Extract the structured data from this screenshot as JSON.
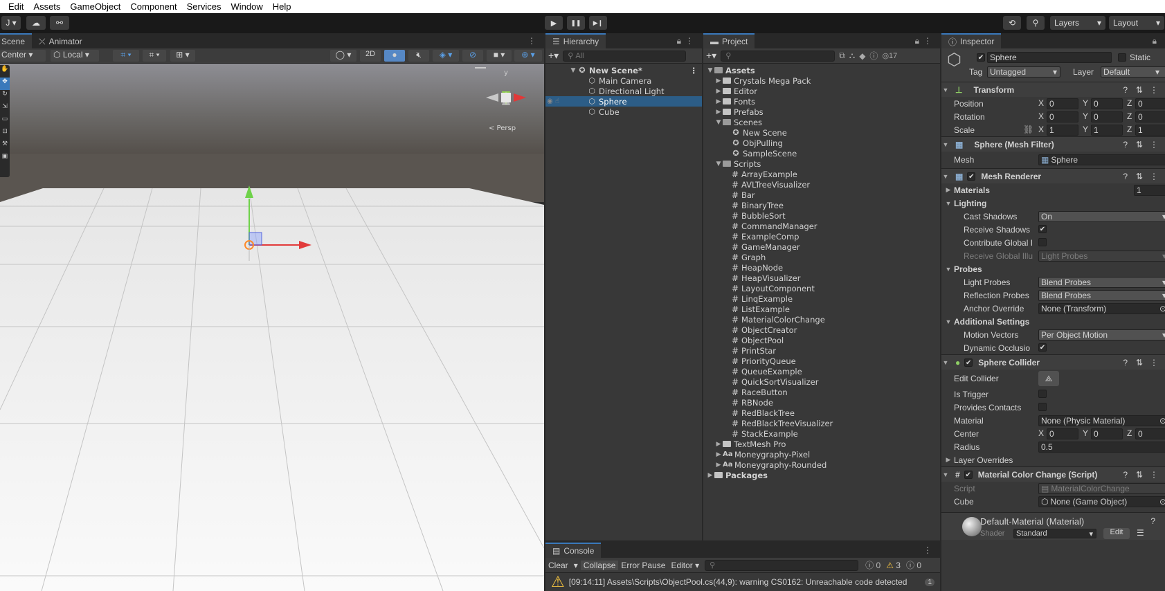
{
  "menu": [
    "Edit",
    "Assets",
    "GameObject",
    "Component",
    "Services",
    "Window",
    "Help"
  ],
  "toolbar": {
    "account": "J",
    "play": "▶",
    "pause": "❚❚",
    "step": "▶❙",
    "layers": "Layers",
    "layout": "Layout"
  },
  "scene": {
    "tabs": [
      "Scene",
      "Animator"
    ],
    "pivot": "Center",
    "space": "Local",
    "mode2d": "2D",
    "persp": "< Persp",
    "gizmo_y": "y"
  },
  "hierarchy": {
    "title": "Hierarchy",
    "search_placeholder": "All",
    "scene": "New Scene*",
    "items": [
      "Main Camera",
      "Directional Light",
      "Sphere",
      "Cube"
    ]
  },
  "project": {
    "title": "Project",
    "count": "17",
    "root": "Assets",
    "folders_top": [
      "Crystals Mega Pack",
      "Editor",
      "Fonts",
      "Prefabs"
    ],
    "scenes_folder": "Scenes",
    "scenes": [
      "New Scene",
      "ObjPulling",
      "SampleScene"
    ],
    "scripts_folder": "Scripts",
    "scripts": [
      "ArrayExample",
      "AVLTreeVisualizer",
      "Bar",
      "BinaryTree",
      "BubbleSort",
      "CommandManager",
      "ExampleComp",
      "GameManager",
      "Graph",
      "HeapNode",
      "HeapVisualizer",
      "LayoutComponent",
      "LinqExample",
      "ListExample",
      "MaterialColorChange",
      "ObjectCreator",
      "ObjectPool",
      "PrintStar",
      "PriorityQueue",
      "QueueExample",
      "QuickSortVisualizer",
      "RaceButton",
      "RBNode",
      "RedBlackTree",
      "RedBlackTreeVisualizer",
      "StackExample"
    ],
    "folders_bottom": [
      "TextMesh Pro"
    ],
    "fonts": [
      "Moneygraphy-Pixel",
      "Moneygraphy-Rounded"
    ],
    "packages": "Packages"
  },
  "console": {
    "title": "Console",
    "clear": "Clear",
    "collapse": "Collapse",
    "error_pause": "Error Pause",
    "editor": "Editor",
    "info_count": "0",
    "warn_count": "3",
    "error_count": "0",
    "message": "[09:14:11] Assets\\Scripts\\ObjectPool.cs(44,9): warning CS0162: Unreachable code detected",
    "msg_count": "1"
  },
  "inspector": {
    "title": "Inspector",
    "object_name": "Sphere",
    "static_label": "Static",
    "tag_label": "Tag",
    "tag": "Untagged",
    "layer_label": "Layer",
    "layer": "Default",
    "transform": {
      "title": "Transform",
      "rows": [
        {
          "label": "Position",
          "x": "0",
          "y": "0",
          "z": "0"
        },
        {
          "label": "Rotation",
          "x": "0",
          "y": "0",
          "z": "0"
        },
        {
          "label": "Scale",
          "x": "1",
          "y": "1",
          "z": "1"
        }
      ]
    },
    "mesh_filter": {
      "title": "Sphere (Mesh Filter)",
      "mesh_label": "Mesh",
      "mesh": "Sphere"
    },
    "mesh_renderer": {
      "title": "Mesh Renderer",
      "materials": "Materials",
      "materials_count": "1",
      "lighting": "Lighting",
      "cast_shadows_label": "Cast Shadows",
      "cast_shadows": "On",
      "receive_shadows": "Receive Shadows",
      "contribute_gi": "Contribute Global I",
      "receive_gi": "Receive Global Illu",
      "receive_gi_value": "Light Probes",
      "probes": "Probes",
      "light_probes_label": "Light Probes",
      "light_probes": "Blend Probes",
      "reflection_probes_label": "Reflection Probes",
      "reflection_probes": "Blend Probes",
      "anchor_label": "Anchor Override",
      "anchor": "None (Transform)",
      "additional": "Additional Settings",
      "motion_label": "Motion Vectors",
      "motion": "Per Object Motion",
      "dynamic_occ": "Dynamic Occlusio"
    },
    "sphere_collider": {
      "title": "Sphere Collider",
      "edit": "Edit Collider",
      "trigger": "Is Trigger",
      "contacts": "Provides Contacts",
      "material_label": "Material",
      "material": "None (Physic Material)",
      "center_label": "Center",
      "cx": "0",
      "cy": "0",
      "cz": "0",
      "radius_label": "Radius",
      "radius": "0.5",
      "layer_overrides": "Layer Overrides"
    },
    "script": {
      "title": "Material Color Change (Script)",
      "script_label": "Script",
      "script": "MaterialColorChange",
      "cube_label": "Cube",
      "cube": "None (Game Object)"
    },
    "material": {
      "name": "Default-Material (Material)",
      "shader_label": "Shader",
      "shader": "Standard",
      "edit": "Edit"
    }
  },
  "colors": {
    "accent": "#3a79bb",
    "selection": "#2c5d87",
    "warning": "#f0c040"
  }
}
